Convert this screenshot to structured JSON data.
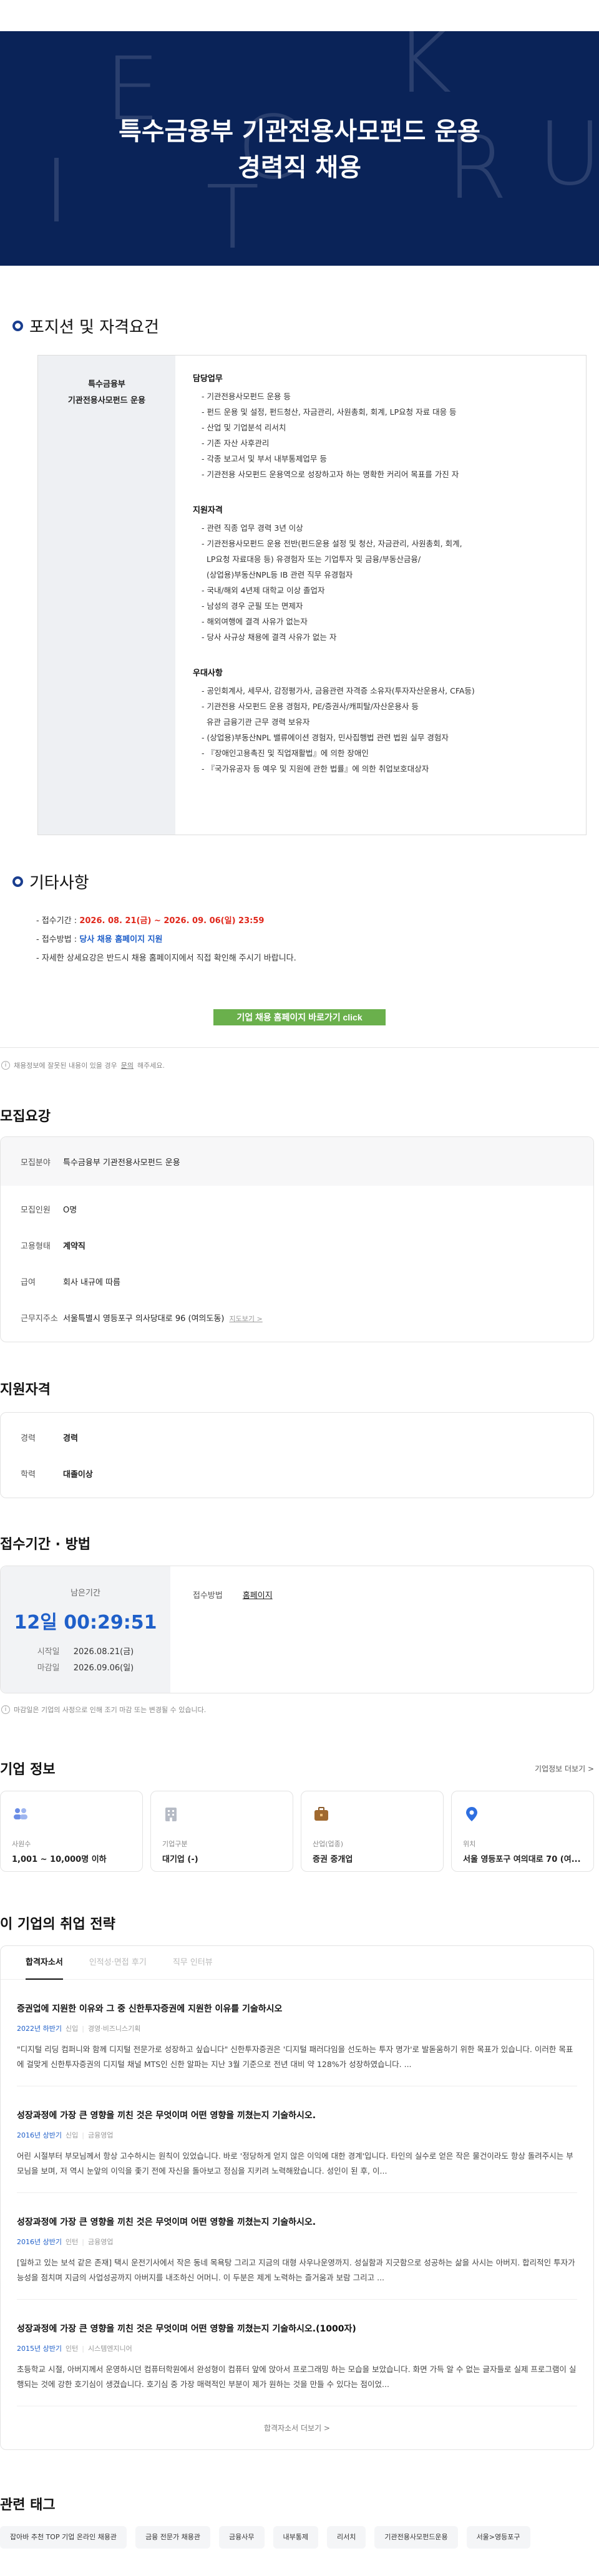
{
  "hero": {
    "deco_letters": [
      "E",
      "C",
      "R",
      "U",
      "I",
      "T",
      "T",
      "M",
      "E",
      "N",
      "K"
    ],
    "title_line1": "특수금융부 기관전용사모펀드 운용",
    "title_line2": "경력직 채용"
  },
  "position": {
    "section_title": "포지션 및 자격요건",
    "left_line1": "특수금융부",
    "left_line2": "기관전용사모펀드 운용",
    "groups": [
      {
        "heading": "담당업무",
        "items": [
          "- 기관전용사모펀드 운용 등",
          "- 펀드 운용 및 설정, 펀드청산, 자금관리, 사원총회, 회계, LP요청 자료 대응 등",
          "- 산업 및 기업분석 리서치",
          "- 기존 자산 사후관리",
          "- 각종 보고서 및 부서 내부통제업무 등",
          "- 기관전용 사모펀드 운용역으로 성장하고자 하는 명확한 커리어 목표를 가진 자"
        ]
      },
      {
        "heading": "지원자격",
        "items": [
          "- 관련 직종 업무 경력 3년 이상",
          "- 기관전용사모펀드 운용 전반(펀드운용 설정 및 청산, 자금관리, 사원총회, 회계,",
          "  LP요청 자료대응 등) 유경험자 또는 기업투자 및 금융/부동산금융/",
          "  (상업용)부동산NPL등 IB 관련 직무 유경험자",
          "- 국내/해외 4년제 대학교 이상 졸업자",
          "- 남성의 경우 군필 또는 면제자",
          "- 해외여행에 결격 사유가 없는자",
          "- 당사 사규상 채용에 결격 사유가 없는 자"
        ]
      },
      {
        "heading": "우대사항",
        "items": [
          "- 공인회계사, 세무사, 감정평가사, 금융관련 자격증 소유자(투자자산운용사, CFA등)",
          "- 기관전용 사모펀드 운용 경험자, PE/증권사/캐피탈/자산운용사 등",
          "  유관 금융기관 근무 경력 보유자",
          "- (상업용)부동산NPL 밸류에이션 경험자, 민사집행법 관련 법원 실무 경험자",
          "- 『장애인고용촉진 및 직업재활법』에 의한 장애인",
          "- 『국가유공자 등 예우 및 지원에 관한 법률』에 의한 취업보호대상자"
        ]
      }
    ]
  },
  "other": {
    "section_title": "기타사항",
    "period_label": "- 접수기간 : ",
    "period_value": "2026. 08. 21(금) ~ 2026. 09. 06(일) 23:59",
    "method_label": "- 접수방법 : ",
    "method_value": "당사 채용 홈페이지 지원",
    "detail": "- 자세한 상세요강은 반드시 채용 홈페이지에서 직접 확인해 주시기 바랍니다.",
    "button_label": "기업 채용 홈페이지 바로가기 click"
  },
  "notice1": {
    "text": "채용정보에 잘못된 내용이 있을 경우 ",
    "link": "문의",
    "after": "해주세요."
  },
  "recruit": {
    "title": "모집요강",
    "rows": [
      {
        "label": "모집분야",
        "value": "특수금융부 기관전용사모펀드 운용"
      },
      {
        "label": "모집인원",
        "value": "O명"
      },
      {
        "label": "고용형태",
        "value": "계약직"
      },
      {
        "label": "급여",
        "value": "회사 내규에 따름"
      },
      {
        "label": "근무지주소",
        "value": "서울특별시 영등포구 의사당대로 96 (여의도동)",
        "link": "지도보기 >"
      }
    ]
  },
  "qualification": {
    "title": "지원자격",
    "rows": [
      {
        "label": "경력",
        "value": "경력"
      },
      {
        "label": "학력",
        "value": "대졸이상"
      }
    ]
  },
  "deadline": {
    "title": "접수기간 · 방법",
    "remaining_label": "남은기간",
    "timer": "12일 00:29:51",
    "start_label": "시작일",
    "start_value": "2026.08.21(금)",
    "end_label": "마감일",
    "end_value": "2026.09.06(일)",
    "method_label": "접수방법",
    "method_value": "홈페이지"
  },
  "notice2": {
    "text": "마감일은 기업의 사정으로 인해 조기 마감 또는 변경될 수 있습니다."
  },
  "company": {
    "title": "기업 정보",
    "more": "기업정보 더보기 >",
    "cards": [
      {
        "icon": "people-icon",
        "label": "사원수",
        "value": "1,001 ~ 10,000명 이하"
      },
      {
        "icon": "building-icon",
        "label": "기업구분",
        "value": "대기업 (-)"
      },
      {
        "icon": "briefcase-icon",
        "label": "산업(업종)",
        "value": "증권 중개업"
      },
      {
        "icon": "location-pin-icon",
        "label": "위치",
        "value": "서울 영등포구 여의대로 70 (여..."
      }
    ]
  },
  "strategy": {
    "title": "이 기업의 취업 전략",
    "tabs": [
      "합격자소서",
      "인적성·면접 후기",
      "직무 인터뷰"
    ],
    "essays": [
      {
        "title": "증권업에 지원한 이유와 그 중 신한투자증권에 지원한 이유를 기술하시오",
        "year": "2022년 하반기",
        "type": "신입",
        "category": "경영·비즈니스기획",
        "body": "\"디지털 리딩 컴퍼니와 함께 디지털 전문가로 성장하고 싶습니다\" 신한투자증권은 '디지털 패러다임을 선도하는 투자 명가'로 발돋움하기 위한 목표가 있습니다. 이러한 목표에 걸맞게 신한투자증권의 디지털 채널 MTS인 신한 알파는 지난 3월 기준으로 전년 대비 약 128%가 성장하였습니다. ..."
      },
      {
        "title": "성장과정에 가장 큰 영향을 끼친 것은 무엇이며 어떤 영향을 끼쳤는지 기술하시오.",
        "year": "2016년 상반기",
        "type": "신입",
        "category": "금융영업",
        "body": "어린 시절부터 부모님께서 항상 고수하시는 원칙이 있었습니다. 바로 '정당하게 얻지 않은 이익에 대한 경계'입니다. 타인의 실수로 얻은 작은 물건이라도 항상 돌려주시는 부모님을 보며, 저 역시 눈앞의 이익을 좇기 전에 자신을 돌아보고 정심을 지키려 노력해왔습니다. 성인이 된 후, 이..."
      },
      {
        "title": "성장과정에 가장 큰 영향을 끼친 것은 무엇이며 어떤 영향을 끼쳤는지 기술하시오.",
        "year": "2016년 상반기",
        "type": "인턴",
        "category": "금융영업",
        "body": "[일하고 있는 보석 같은 존재] 택시 운전기사에서 작은 동네 목욕탕 그리고 지금의 대형 사우나운영까지. 성실함과 지긋함으로 성공하는 삶을 사시는 아버지. 합리적인 투자가능성을 점치며 지금의 사업성공까지 아버지를 내조하신 어머니. 이 두분은 제게 노력하는 즐거움과 보람 그리고 ..."
      },
      {
        "title": "성장과정에 가장 큰 영향을 끼친 것은 무엇이며 어떤 영향을 끼쳤는지 기술하시오.(1000자)",
        "year": "2015년 상반기",
        "type": "인턴",
        "category": "시스템엔지니어",
        "body": "초등학교 시절, 아버지께서 운영하시던 컴퓨터학원에서 완성형이 컴퓨터 앞에 앉아서 프로그래밍 하는 모습을 보았습니다. 화면 가득 알 수 없는 글자들로 실제 프로그램이 실행되는 것에 강한 호기심이 생겼습니다. 호기심 중 가장 매력적인 부분이 제가 원하는 것을 만들 수 있다는 점이었..."
      }
    ],
    "more": "합격자소서 더보기 >"
  },
  "tags": {
    "title": "관련 태그",
    "items": [
      "잡아바 추천 TOP 기업 온라인 채용관",
      "금융 전문가 채용관",
      "금융사무",
      "내부통제",
      "리서치",
      "기관전용사모펀드운용",
      "서울>영등포구"
    ]
  },
  "colors": {
    "hero_bg": "#0a2358",
    "accent_blue": "#1f5fc9",
    "red": "#e0271b",
    "button_green": "#6ab04c"
  }
}
